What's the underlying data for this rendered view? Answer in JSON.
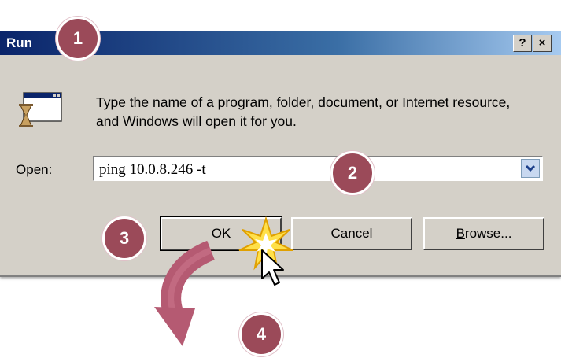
{
  "window": {
    "title": "Run",
    "help_button": "?",
    "close_button": "×"
  },
  "description": "Type the name of a program, folder, document, or Internet resource, and Windows will open it for you.",
  "open": {
    "label_accel": "O",
    "label_rest": "pen:",
    "value": "ping 10.0.8.246 -t"
  },
  "buttons": {
    "ok": "OK",
    "cancel": "Cancel",
    "browse_accel": "B",
    "browse_rest": "rowse..."
  },
  "callouts": [
    "1",
    "2",
    "3",
    "4"
  ],
  "icons": {
    "program": "run-program-icon",
    "dropdown": "chevron-down-icon",
    "cursor": "mouse-pointer-icon",
    "click": "click-burst-icon",
    "arrow": "curved-arrow-icon"
  },
  "colors": {
    "callout": "#9b4a59",
    "arrow": "#b55a72",
    "titlebar": "#0a246a",
    "dialog": "#d4d0c8"
  }
}
